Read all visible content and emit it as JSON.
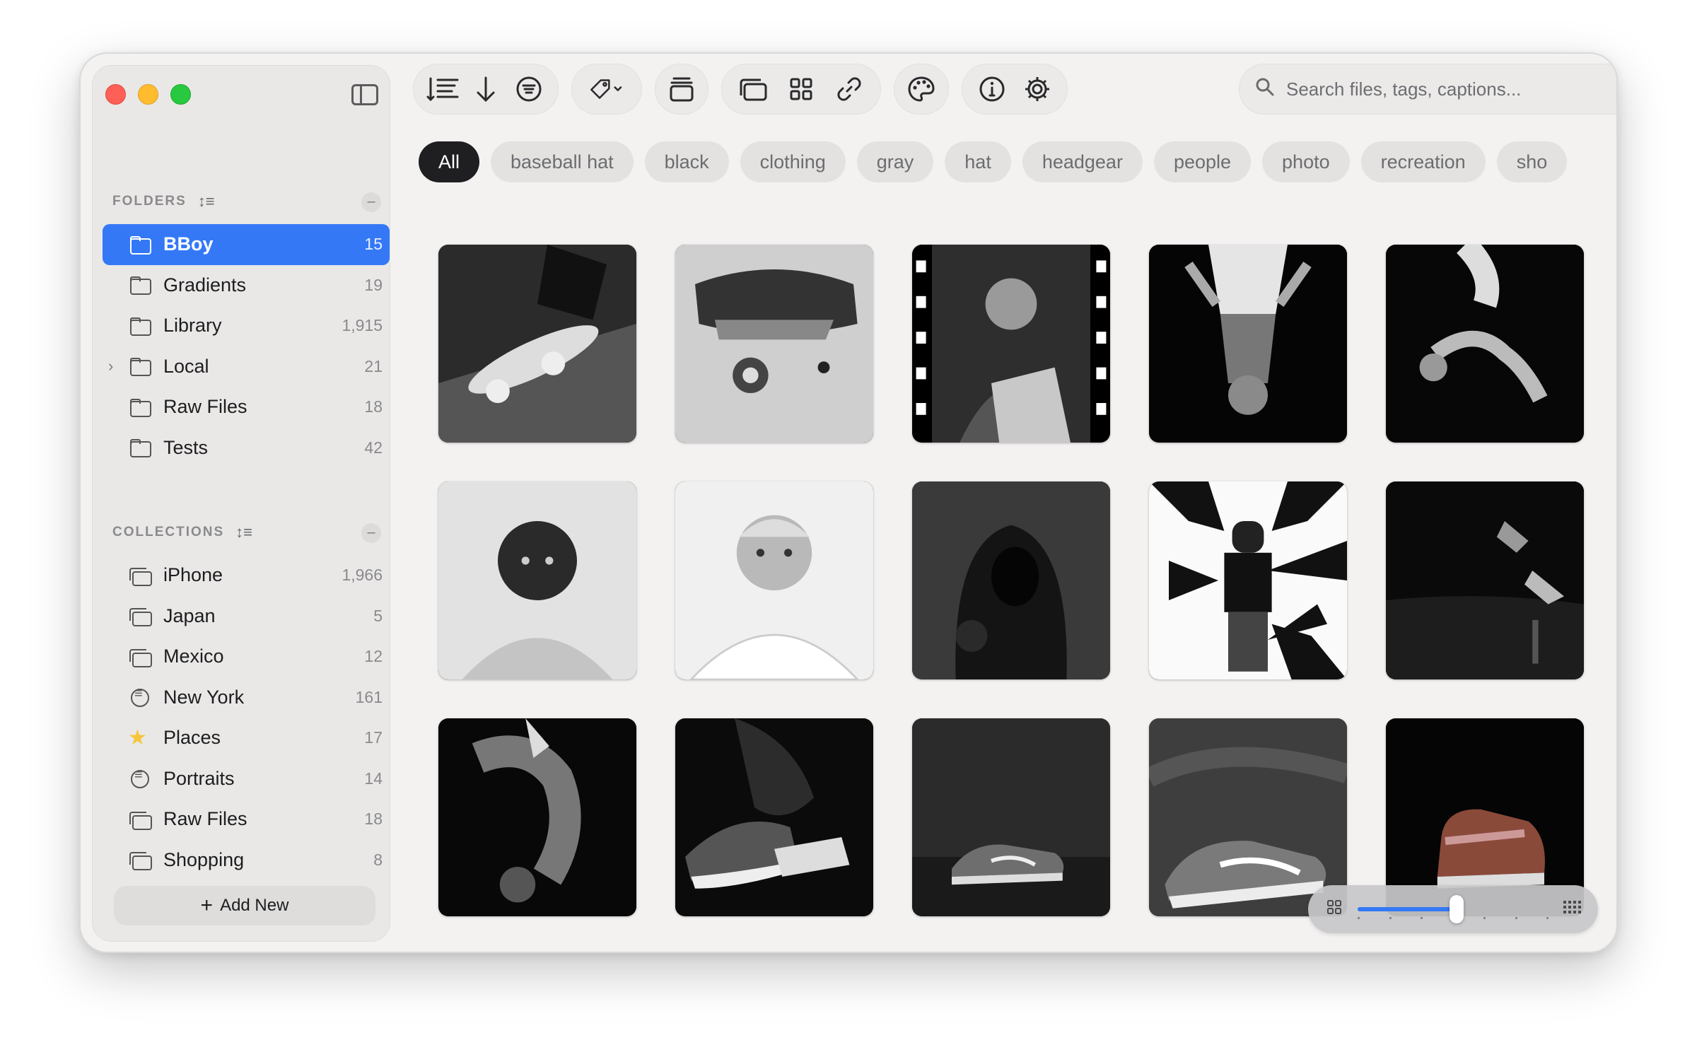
{
  "sidebar": {
    "folders_title": "FOLDERS",
    "folders": [
      {
        "label": "BBoy",
        "count": "15",
        "active": true
      },
      {
        "label": "Gradients",
        "count": "19"
      },
      {
        "label": "Library",
        "count": "1,915"
      },
      {
        "label": "Local",
        "count": "21",
        "expandable": true
      },
      {
        "label": "Raw Files",
        "count": "18"
      },
      {
        "label": "Tests",
        "count": "42"
      }
    ],
    "collections_title": "COLLECTIONS",
    "collections": [
      {
        "label": "iPhone",
        "count": "1,966",
        "icon": "collection-icon"
      },
      {
        "label": "Japan",
        "count": "5",
        "icon": "collection-icon"
      },
      {
        "label": "Mexico",
        "count": "12",
        "icon": "collection-icon"
      },
      {
        "label": "New York",
        "count": "161",
        "icon": "smart-collection-icon"
      },
      {
        "label": "Places",
        "count": "17",
        "icon": "star-icon"
      },
      {
        "label": "Portraits",
        "count": "14",
        "icon": "smart-collection-icon"
      },
      {
        "label": "Raw Files",
        "count": "18",
        "icon": "collection-icon"
      },
      {
        "label": "Shopping",
        "count": "8",
        "icon": "collection-icon"
      }
    ],
    "add_new_label": "Add New"
  },
  "toolbar": {
    "icons": {
      "sort": "sort-lines-icon",
      "direction": "arrow-down-icon",
      "filter": "filter-icon",
      "tag": "tag-icon",
      "stack": "stack-icon",
      "collections": "collections-icon",
      "grid": "grid-icon",
      "link": "link-icon",
      "palette": "palette-icon",
      "info": "info-icon",
      "settings": "gear-icon"
    }
  },
  "search": {
    "placeholder": "Search files, tags, captions..."
  },
  "tags": [
    "All",
    "baseball hat",
    "black",
    "clothing",
    "gray",
    "hat",
    "headgear",
    "people",
    "photo",
    "recreation",
    "sho"
  ],
  "active_tag": "All",
  "photos": [
    "skateboard-closeup",
    "sneaker-on-skateboard",
    "film-portrait-35mm",
    "upside-down-dancer",
    "bboy-backflip",
    "man-portrait-tshirt",
    "man-portrait-cap",
    "hooded-figure",
    "man-with-arrows",
    "feet-on-wet-floor",
    "bboy-freeze",
    "sneaker-dance",
    "sneaker-dark",
    "sneaker-gray",
    "sneaker-color"
  ],
  "zoom": {
    "value": 0.52,
    "accent": "#3478f6"
  },
  "colors": {
    "accent": "#3478f6",
    "tag_active": "#1f1f21"
  }
}
